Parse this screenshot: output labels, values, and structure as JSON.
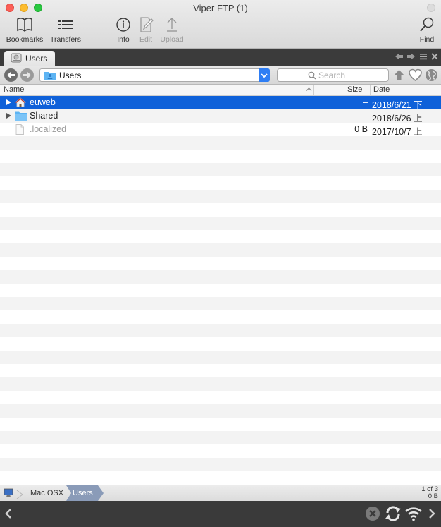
{
  "window": {
    "title": "Viper FTP (1)"
  },
  "toolbar": {
    "bookmarks": "Bookmarks",
    "transfers": "Transfers",
    "info": "Info",
    "edit": "Edit",
    "upload": "Upload",
    "find": "Find"
  },
  "tab": {
    "label": "Users"
  },
  "navbar": {
    "path": "Users",
    "search_placeholder": "Search",
    "search_value": ""
  },
  "columns": {
    "name": "Name",
    "size": "Size",
    "date": "Date"
  },
  "files": [
    {
      "name": "euweb",
      "size": "–",
      "date": "2018/6/21 下",
      "icon": "home-folder-icon",
      "expandable": true,
      "selected": true
    },
    {
      "name": "Shared",
      "size": "–",
      "date": "2018/6/26 上",
      "icon": "folder-icon",
      "expandable": true,
      "selected": false
    },
    {
      "name": ".localized",
      "size": "0 B",
      "date": "2017/10/7 上",
      "icon": "document-icon",
      "expandable": false,
      "selected": false
    }
  ],
  "pathbar": {
    "crumbs": [
      "Mac  OSX",
      "Users"
    ],
    "count": "1 of 3",
    "total_size": "0 B"
  },
  "colors": {
    "selection": "#0f61d9",
    "accent": "#2f7ef4",
    "folder": "#5db4f3"
  }
}
